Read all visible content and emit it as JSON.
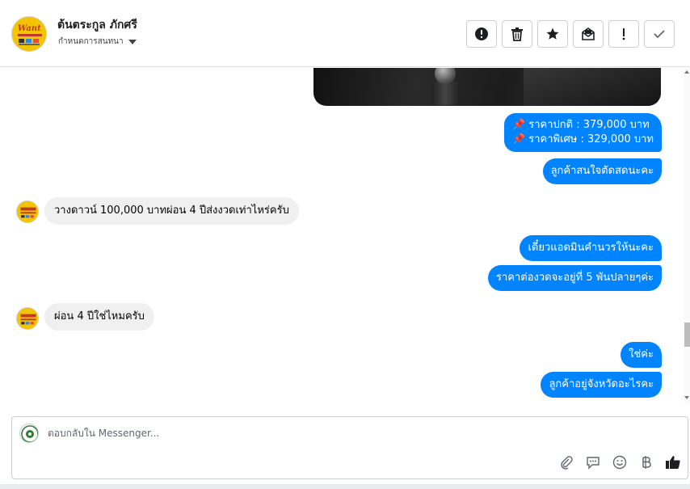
{
  "header": {
    "contact_name": "ต้นตระกูล ภักศรี",
    "label_dropdown": "กำหนดการสนทนา",
    "logo_text": "Want",
    "toolbar": [
      {
        "name": "spam-button",
        "icon": "exclamation-circle-icon"
      },
      {
        "name": "delete-button",
        "icon": "trash-icon"
      },
      {
        "name": "star-button",
        "icon": "star-icon"
      },
      {
        "name": "mark-unread-button",
        "icon": "envelope-open-icon"
      },
      {
        "name": "follow-up-button",
        "icon": "exclamation-icon"
      },
      {
        "name": "done-button",
        "icon": "check-icon"
      }
    ]
  },
  "messages": {
    "price_normal": "ราคาปกติ : 379,000 บาท",
    "price_special": "ราคาพิเศษ : 329,000 บาท",
    "out_1": "ลูกค้าสนใจตัดสดนะคะ",
    "in_1": "วางดาวน์ 100,000 บาทผ่อน 4 ปีส่งงวดเท่าไหร่ครับ",
    "out_2": "เดี๋ยวแอดมินคำนวรให้นะคะ",
    "out_3": "ราคาต่องวดจะอยู่ที่ 5 พันปลายๆค่ะ",
    "in_2": "ผ่อน 4 ปีใช่ไหมครับ",
    "out_4": "ใช่ค่ะ",
    "out_5": "ลูกค้าอยู่จังหวัดอะไรคะ"
  },
  "composer": {
    "placeholder": "ตอบกลับใน Messenger..."
  },
  "colors": {
    "outgoing_bubble": "#0084ff",
    "incoming_bubble": "#f0f0f0",
    "logo_yellow": "#f5c400"
  }
}
